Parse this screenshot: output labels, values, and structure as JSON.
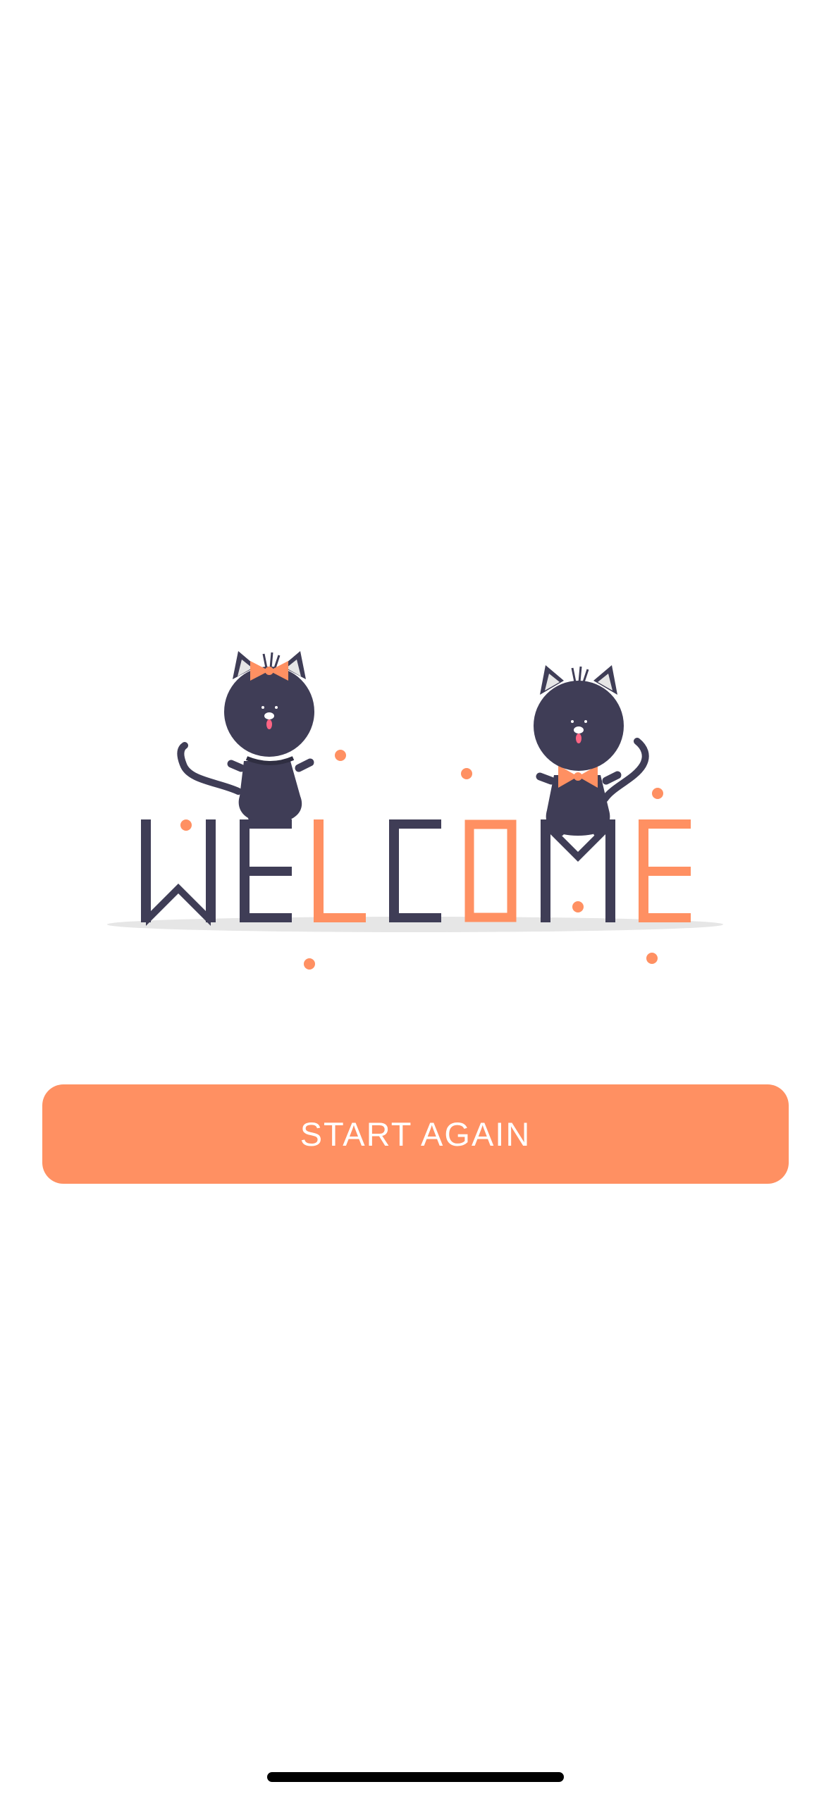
{
  "screen": {
    "background": "#FFFFFF"
  },
  "illustration": {
    "name": "welcome-cats-illustration",
    "letters": [
      "W",
      "E",
      "L",
      "C",
      "O",
      "M",
      "E"
    ],
    "colors": {
      "dark": "#3F3D56",
      "accent": "#FF9062",
      "shadow": "#E6E6E6",
      "tongue": "#FF6584"
    }
  },
  "start_button": {
    "label": "START AGAIN",
    "color": "#FF9062"
  },
  "home_indicator": {
    "color": "#000000"
  }
}
